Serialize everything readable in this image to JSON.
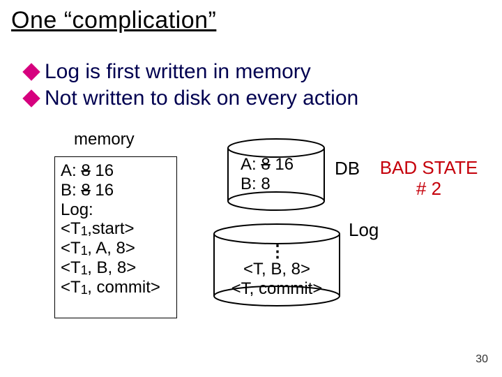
{
  "title": "One “complication”",
  "bullets": [
    "Log is first written in memory",
    "Not written to disk on every action"
  ],
  "memory": {
    "label": "memory",
    "a_pre": "A:",
    "a_struck": "8",
    "a_val": "16",
    "b_pre": "B:",
    "b_struck": "8",
    "b_val": "16",
    "log_label": "Log:",
    "log_entries": [
      "<T1,start>",
      "<T1, A, 8>",
      "<T1, B, 8>",
      "<T1, commit>"
    ]
  },
  "db": {
    "label": "DB",
    "a_pre": "A:",
    "a_struck": "8",
    "a_val": "16",
    "b_line": "B: 8"
  },
  "log_disk": {
    "label": "Log",
    "entries": [
      "<T, B, 8>",
      "<T, commit>"
    ]
  },
  "bad_state": {
    "line1": "BAD STATE",
    "line2": "# 2"
  },
  "page_number": "30"
}
